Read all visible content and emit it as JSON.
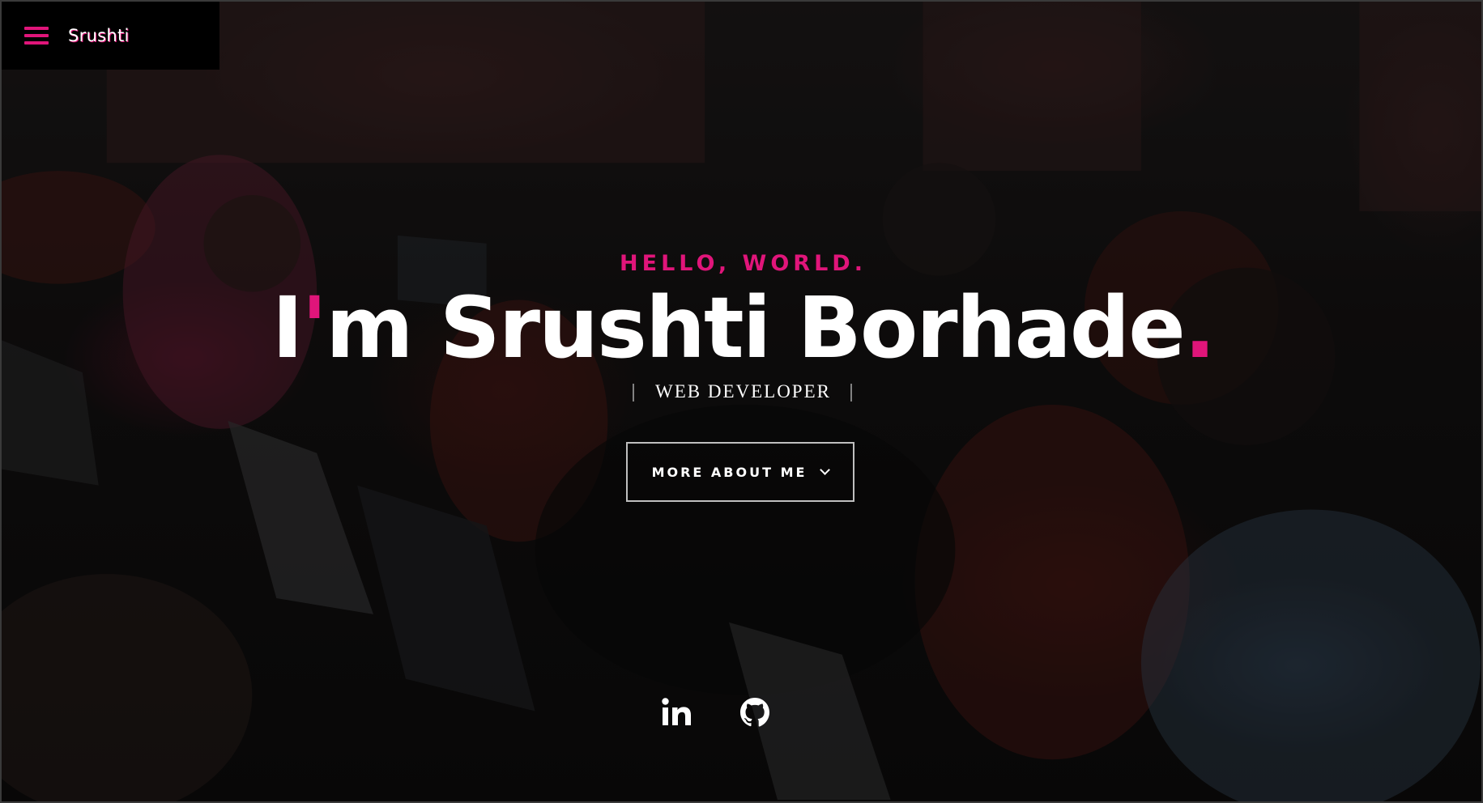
{
  "nav": {
    "menu_icon": "hamburger-menu-icon",
    "brand": "Srushti"
  },
  "intro": {
    "greeting": "HELLO, WORLD.",
    "headline_start": "I",
    "headline_apostrophe": "'",
    "headline_rest": "m Srushti Borhade",
    "headline_period": ".",
    "role_bar_left": "|",
    "role": "WEB DEVELOPER",
    "role_bar_right": "|",
    "cta_label": "MORE ABOUT ME",
    "cta_icon": "chevron-down-icon"
  },
  "social": {
    "links": [
      {
        "icon": "linkedin-icon",
        "label": "LinkedIn"
      },
      {
        "icon": "github-icon",
        "label": "GitHub"
      }
    ]
  },
  "colors": {
    "accent": "#e0157a",
    "text": "#ffffff",
    "nav_background": "#000000"
  }
}
